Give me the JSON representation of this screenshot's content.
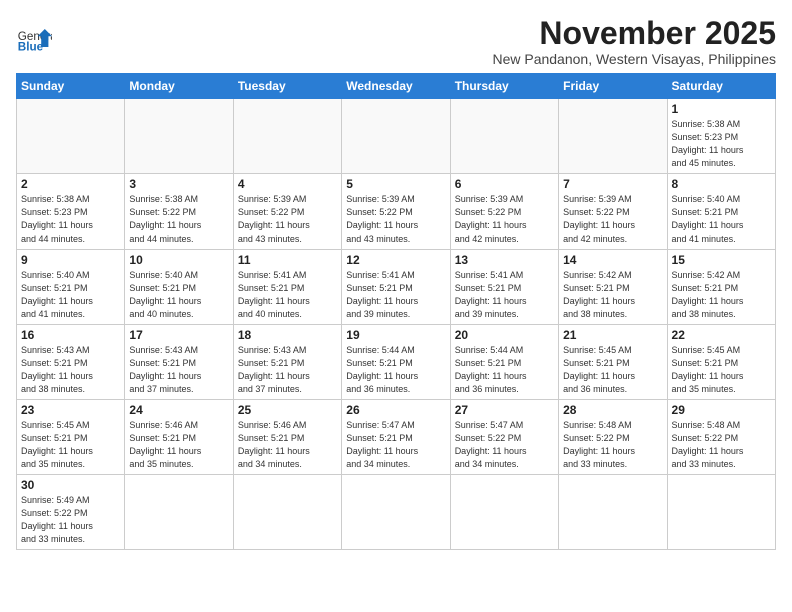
{
  "header": {
    "logo_general": "General",
    "logo_blue": "Blue",
    "month_title": "November 2025",
    "location": "New Pandanon, Western Visayas, Philippines"
  },
  "weekdays": [
    "Sunday",
    "Monday",
    "Tuesday",
    "Wednesday",
    "Thursday",
    "Friday",
    "Saturday"
  ],
  "weeks": [
    [
      {
        "day": "",
        "info": ""
      },
      {
        "day": "",
        "info": ""
      },
      {
        "day": "",
        "info": ""
      },
      {
        "day": "",
        "info": ""
      },
      {
        "day": "",
        "info": ""
      },
      {
        "day": "",
        "info": ""
      },
      {
        "day": "1",
        "info": "Sunrise: 5:38 AM\nSunset: 5:23 PM\nDaylight: 11 hours\nand 45 minutes."
      }
    ],
    [
      {
        "day": "2",
        "info": "Sunrise: 5:38 AM\nSunset: 5:23 PM\nDaylight: 11 hours\nand 44 minutes."
      },
      {
        "day": "3",
        "info": "Sunrise: 5:38 AM\nSunset: 5:22 PM\nDaylight: 11 hours\nand 44 minutes."
      },
      {
        "day": "4",
        "info": "Sunrise: 5:39 AM\nSunset: 5:22 PM\nDaylight: 11 hours\nand 43 minutes."
      },
      {
        "day": "5",
        "info": "Sunrise: 5:39 AM\nSunset: 5:22 PM\nDaylight: 11 hours\nand 43 minutes."
      },
      {
        "day": "6",
        "info": "Sunrise: 5:39 AM\nSunset: 5:22 PM\nDaylight: 11 hours\nand 42 minutes."
      },
      {
        "day": "7",
        "info": "Sunrise: 5:39 AM\nSunset: 5:22 PM\nDaylight: 11 hours\nand 42 minutes."
      },
      {
        "day": "8",
        "info": "Sunrise: 5:40 AM\nSunset: 5:21 PM\nDaylight: 11 hours\nand 41 minutes."
      }
    ],
    [
      {
        "day": "9",
        "info": "Sunrise: 5:40 AM\nSunset: 5:21 PM\nDaylight: 11 hours\nand 41 minutes."
      },
      {
        "day": "10",
        "info": "Sunrise: 5:40 AM\nSunset: 5:21 PM\nDaylight: 11 hours\nand 40 minutes."
      },
      {
        "day": "11",
        "info": "Sunrise: 5:41 AM\nSunset: 5:21 PM\nDaylight: 11 hours\nand 40 minutes."
      },
      {
        "day": "12",
        "info": "Sunrise: 5:41 AM\nSunset: 5:21 PM\nDaylight: 11 hours\nand 39 minutes."
      },
      {
        "day": "13",
        "info": "Sunrise: 5:41 AM\nSunset: 5:21 PM\nDaylight: 11 hours\nand 39 minutes."
      },
      {
        "day": "14",
        "info": "Sunrise: 5:42 AM\nSunset: 5:21 PM\nDaylight: 11 hours\nand 38 minutes."
      },
      {
        "day": "15",
        "info": "Sunrise: 5:42 AM\nSunset: 5:21 PM\nDaylight: 11 hours\nand 38 minutes."
      }
    ],
    [
      {
        "day": "16",
        "info": "Sunrise: 5:43 AM\nSunset: 5:21 PM\nDaylight: 11 hours\nand 38 minutes."
      },
      {
        "day": "17",
        "info": "Sunrise: 5:43 AM\nSunset: 5:21 PM\nDaylight: 11 hours\nand 37 minutes."
      },
      {
        "day": "18",
        "info": "Sunrise: 5:43 AM\nSunset: 5:21 PM\nDaylight: 11 hours\nand 37 minutes."
      },
      {
        "day": "19",
        "info": "Sunrise: 5:44 AM\nSunset: 5:21 PM\nDaylight: 11 hours\nand 36 minutes."
      },
      {
        "day": "20",
        "info": "Sunrise: 5:44 AM\nSunset: 5:21 PM\nDaylight: 11 hours\nand 36 minutes."
      },
      {
        "day": "21",
        "info": "Sunrise: 5:45 AM\nSunset: 5:21 PM\nDaylight: 11 hours\nand 36 minutes."
      },
      {
        "day": "22",
        "info": "Sunrise: 5:45 AM\nSunset: 5:21 PM\nDaylight: 11 hours\nand 35 minutes."
      }
    ],
    [
      {
        "day": "23",
        "info": "Sunrise: 5:45 AM\nSunset: 5:21 PM\nDaylight: 11 hours\nand 35 minutes."
      },
      {
        "day": "24",
        "info": "Sunrise: 5:46 AM\nSunset: 5:21 PM\nDaylight: 11 hours\nand 35 minutes."
      },
      {
        "day": "25",
        "info": "Sunrise: 5:46 AM\nSunset: 5:21 PM\nDaylight: 11 hours\nand 34 minutes."
      },
      {
        "day": "26",
        "info": "Sunrise: 5:47 AM\nSunset: 5:21 PM\nDaylight: 11 hours\nand 34 minutes."
      },
      {
        "day": "27",
        "info": "Sunrise: 5:47 AM\nSunset: 5:22 PM\nDaylight: 11 hours\nand 34 minutes."
      },
      {
        "day": "28",
        "info": "Sunrise: 5:48 AM\nSunset: 5:22 PM\nDaylight: 11 hours\nand 33 minutes."
      },
      {
        "day": "29",
        "info": "Sunrise: 5:48 AM\nSunset: 5:22 PM\nDaylight: 11 hours\nand 33 minutes."
      }
    ],
    [
      {
        "day": "30",
        "info": "Sunrise: 5:49 AM\nSunset: 5:22 PM\nDaylight: 11 hours\nand 33 minutes."
      },
      {
        "day": "",
        "info": ""
      },
      {
        "day": "",
        "info": ""
      },
      {
        "day": "",
        "info": ""
      },
      {
        "day": "",
        "info": ""
      },
      {
        "day": "",
        "info": ""
      },
      {
        "day": "",
        "info": ""
      }
    ]
  ]
}
